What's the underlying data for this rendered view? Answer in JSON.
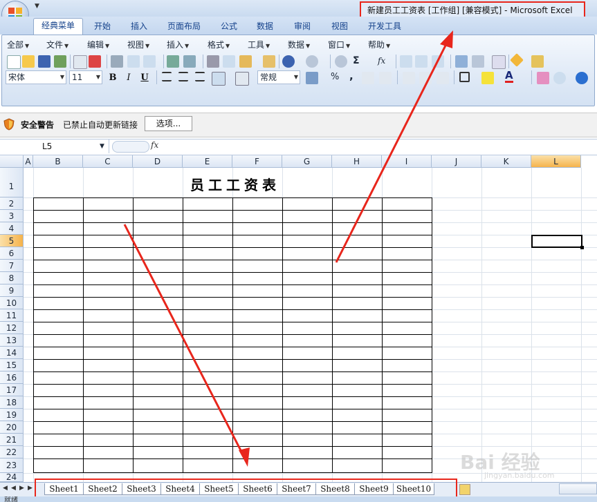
{
  "window": {
    "title": "新建员工工资表  [工作组]  [兼容模式] - Microsoft Excel"
  },
  "ribbon_tabs": [
    {
      "label": "经典菜单",
      "active": true
    },
    {
      "label": "开始"
    },
    {
      "label": "插入"
    },
    {
      "label": "页面布局"
    },
    {
      "label": "公式"
    },
    {
      "label": "数据"
    },
    {
      "label": "审阅"
    },
    {
      "label": "视图"
    },
    {
      "label": "开发工具"
    }
  ],
  "menus": [
    "全部",
    "文件",
    "编辑",
    "视图",
    "插入",
    "格式",
    "工具",
    "数据",
    "窗口",
    "帮助"
  ],
  "toolbar": {
    "font_name": "宋体",
    "font_size": "11",
    "bold": "B",
    "italic": "I",
    "underline": "U",
    "number_format": "常规",
    "percent": "%",
    "comma": ",",
    "sigma": "Σ",
    "fx": "fx"
  },
  "security_bar": {
    "title": "安全警告",
    "message": "已禁止自动更新链接",
    "options_button": "选项..."
  },
  "formula_bar": {
    "name_box": "L5",
    "fx_label": "fx",
    "content": ""
  },
  "sheet": {
    "columns": [
      "A",
      "B",
      "C",
      "D",
      "E",
      "F",
      "G",
      "H",
      "I",
      "J",
      "K",
      "L"
    ],
    "selected_column": "L",
    "rows": [
      "1",
      "2",
      "3",
      "4",
      "5",
      "6",
      "7",
      "8",
      "9",
      "10",
      "11",
      "12",
      "13",
      "14",
      "15",
      "16",
      "17",
      "18",
      "19",
      "20",
      "21",
      "22",
      "23",
      "24"
    ],
    "selected_row": "5",
    "table_title": "员工工资表"
  },
  "sheet_tabs": [
    "Sheet1",
    "Sheet2",
    "Sheet3",
    "Sheet4",
    "Sheet5",
    "Sheet6",
    "Sheet7",
    "Sheet8",
    "Sheet9",
    "Sheet10"
  ],
  "status": {
    "text": "就绪"
  },
  "watermark": {
    "brand": "Bai 经验",
    "sub": "jingyan.baidu.com"
  },
  "colors": {
    "annotation": "#e8261c",
    "ribbon_accent": "#15428b",
    "selected_header": "#f5b34c"
  }
}
